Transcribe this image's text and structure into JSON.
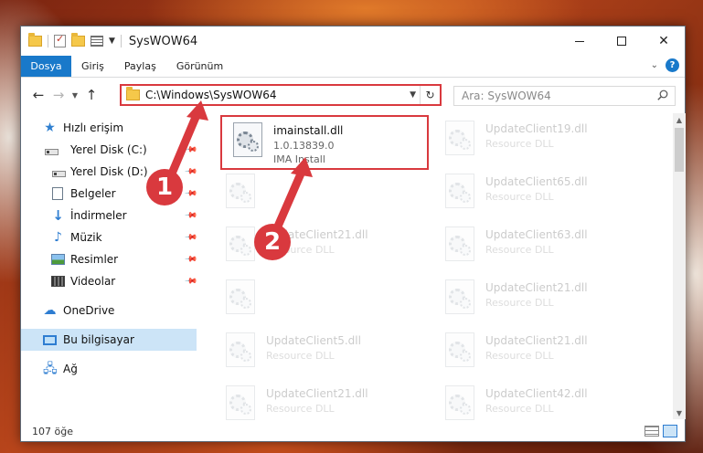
{
  "window": {
    "title": "SysWOW64"
  },
  "ribbon": {
    "tabs": [
      "Dosya",
      "Giriş",
      "Paylaş",
      "Görünüm"
    ]
  },
  "address": {
    "path": "C:\\Windows\\SysWOW64"
  },
  "search": {
    "placeholder": "Ara: SysWOW64"
  },
  "sidebar": {
    "items": [
      {
        "label": "Hızlı erişim",
        "icon": "star-icon"
      },
      {
        "label": "Yerel Disk (C:)",
        "icon": "drive-icon"
      },
      {
        "label": "Yerel Disk (D:)",
        "icon": "drive-icon"
      },
      {
        "label": "Belgeler",
        "icon": "documents-icon"
      },
      {
        "label": "İndirmeler",
        "icon": "download-icon"
      },
      {
        "label": "Müzik",
        "icon": "music-icon"
      },
      {
        "label": "Resimler",
        "icon": "pictures-icon"
      },
      {
        "label": "Videolar",
        "icon": "videos-icon"
      },
      {
        "label": "OneDrive",
        "icon": "cloud-icon"
      },
      {
        "label": "Bu bilgisayar",
        "icon": "computer-icon"
      },
      {
        "label": "Ağ",
        "icon": "network-icon"
      }
    ]
  },
  "files": [
    {
      "name": "imainstall.dll",
      "type": "1.0.13839.0",
      "desc": "IMA Install"
    },
    {
      "name": "UpdateClient19.dll",
      "type": "Resource DLL"
    },
    {
      "name": "",
      "type": ""
    },
    {
      "name": "UpdateClient65.dll",
      "type": "Resource DLL"
    },
    {
      "name": "UpdateClient21.dll",
      "type": "Resource DLL"
    },
    {
      "name": "UpdateClient63.dll",
      "type": "Resource DLL"
    },
    {
      "name": "",
      "type": ""
    },
    {
      "name": "UpdateClient21.dll",
      "type": "Resource DLL"
    },
    {
      "name": "UpdateClient5.dll",
      "type": "Resource DLL"
    },
    {
      "name": "UpdateClient21.dll",
      "type": "Resource DLL"
    },
    {
      "name": "UpdateClient21.dll",
      "type": "Resource DLL"
    },
    {
      "name": "UpdateClient42.dll",
      "type": "Resource DLL"
    }
  ],
  "status": {
    "count": "107 öğe"
  },
  "callouts": [
    "1",
    "2"
  ],
  "colors": {
    "accent": "#1979ca",
    "highlight": "#d9393e",
    "selected": "#cce4f7"
  }
}
